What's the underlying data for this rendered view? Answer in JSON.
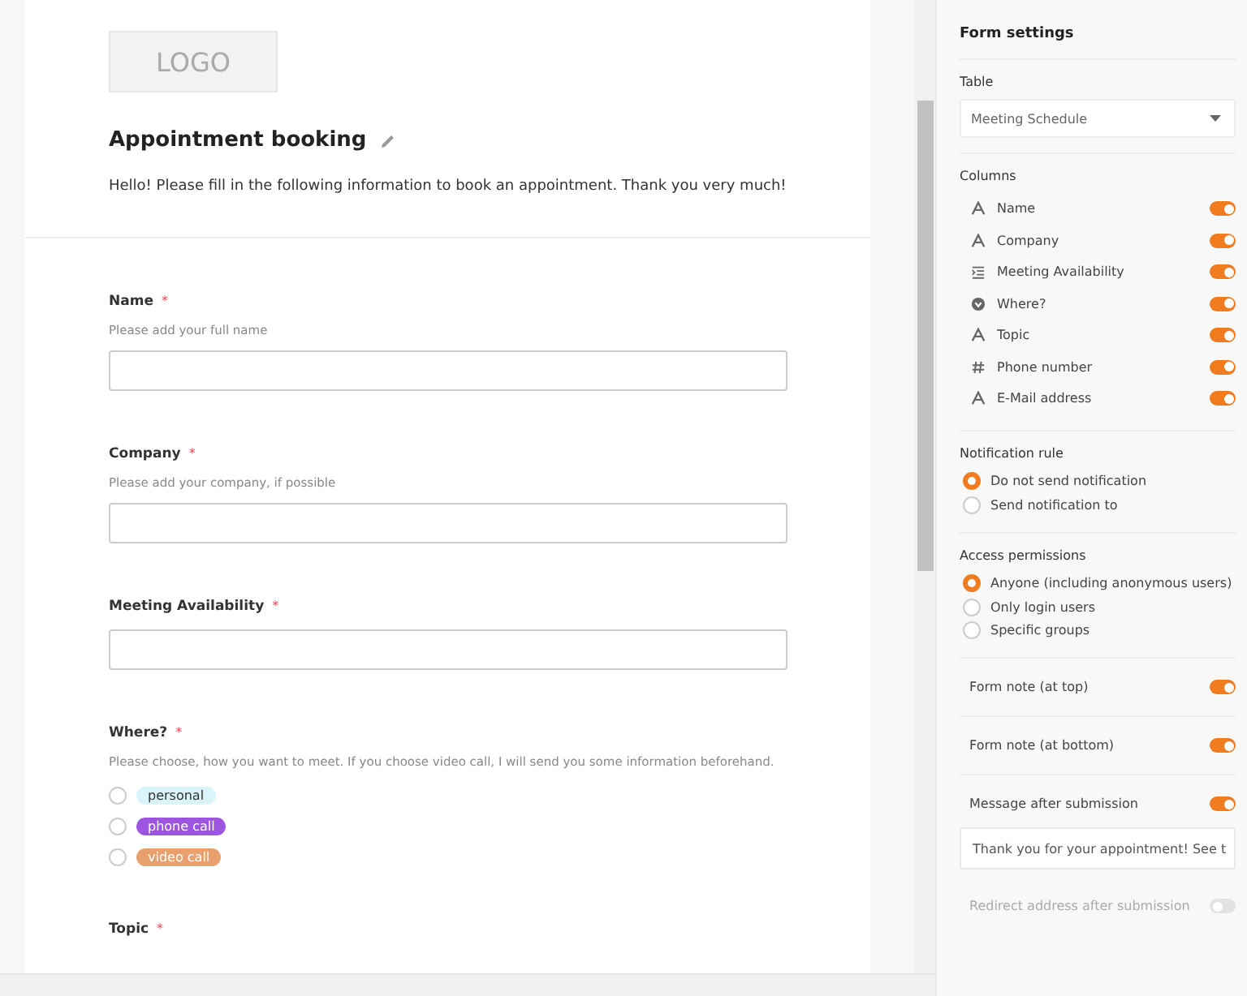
{
  "form": {
    "logo": "LOGO",
    "title": "Appointment booking",
    "description": "Hello! Please fill in the following information to book an appointment. Thank you very much!",
    "fields": [
      {
        "kind": "text",
        "label": "Name",
        "required_mark": "*",
        "hint": "Please add your full name"
      },
      {
        "kind": "text",
        "label": "Company",
        "required_mark": "*",
        "hint": "Please add your company, if possible"
      },
      {
        "kind": "text",
        "label": "Meeting Availability",
        "required_mark": "*"
      },
      {
        "kind": "radio",
        "label": "Where?",
        "required_mark": "*",
        "hint": "Please choose, how you want to meet. If you choose video call, I will send you some information beforehand.",
        "options": [
          {
            "label": "personal",
            "color": "#d9f5fa",
            "selected": false
          },
          {
            "label": "phone call",
            "color": "#9b55e0",
            "selected": false
          },
          {
            "label": "video call",
            "color": "#e9a06f",
            "selected": false
          }
        ]
      },
      {
        "kind": "label",
        "label": "Topic",
        "required_mark": "*"
      }
    ]
  },
  "settings": {
    "title": "Form settings",
    "table": {
      "label": "Table",
      "value": "Meeting Schedule"
    },
    "columns": {
      "label": "Columns",
      "items": [
        {
          "kind": "text",
          "label": "Name",
          "on": true
        },
        {
          "kind": "text",
          "label": "Company",
          "on": true
        },
        {
          "kind": "long-text",
          "label": "Meeting Availability",
          "on": true
        },
        {
          "kind": "select",
          "label": "Where?",
          "on": true
        },
        {
          "kind": "text",
          "label": "Topic",
          "on": true
        },
        {
          "kind": "number",
          "label": "Phone number",
          "on": true
        },
        {
          "kind": "text",
          "label": "E-Mail address",
          "on": true
        }
      ]
    },
    "notification": {
      "label": "Notification rule",
      "options": [
        {
          "label": "Do not send notification",
          "selected": true
        },
        {
          "label": "Send notification to",
          "selected": false
        }
      ]
    },
    "access": {
      "label": "Access permissions",
      "options": [
        {
          "label": "Anyone (including anonymous users)",
          "selected": true
        },
        {
          "label": "Only login users",
          "selected": false
        },
        {
          "label": "Specific groups",
          "selected": false
        }
      ]
    },
    "toggles": [
      {
        "label": "Form note (at top)",
        "on": true
      },
      {
        "label": "Form note (at bottom)",
        "on": true
      },
      {
        "label": "Message after submission",
        "on": true
      }
    ],
    "message": "Thank you for your appointment! See t",
    "redirect": {
      "label": "Redirect address after submission",
      "on": false
    }
  }
}
